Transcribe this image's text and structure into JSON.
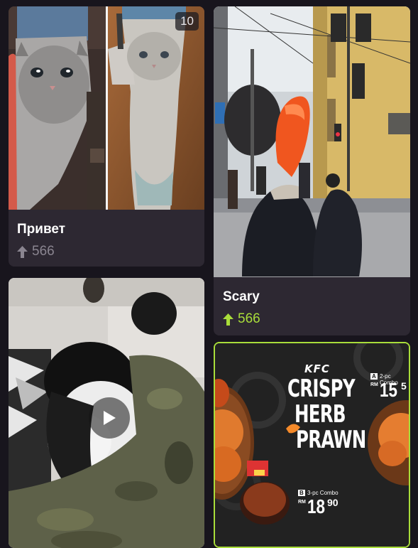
{
  "colors": {
    "background": "#18151d",
    "card": "#2d2832",
    "accent_green": "#a9dd3a",
    "muted": "#8a8590"
  },
  "cards": [
    {
      "title": "Привет",
      "score": "566",
      "score_active": false,
      "image_count": "10",
      "image": "cat-socks-photo"
    },
    {
      "title": "Scary",
      "score": "566",
      "score_active": true,
      "image": "street-inflatable-photo"
    },
    {
      "image": "kitten-video",
      "is_video": true,
      "play_icon": "play-icon"
    },
    {
      "image": "kfc-advertisement",
      "ad": {
        "brand": "KFC",
        "line1": "CRISPY",
        "line2": "HERB",
        "line3": "PRAWN",
        "combo_a_label": "2-pc Combo",
        "combo_a_price": "15",
        "combo_a_cents": "5",
        "combo_b_label": "3-pc Combo",
        "combo_b_currency": "RM",
        "combo_b_price": "18",
        "combo_b_cents": "90",
        "combo_a_tag": "A",
        "combo_b_tag": "B",
        "combo_a_currency": "RM"
      }
    }
  ]
}
